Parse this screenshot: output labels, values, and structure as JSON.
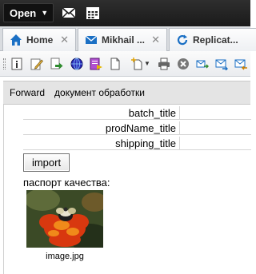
{
  "topbar": {
    "open_label": "Open"
  },
  "tabs": [
    {
      "label": "Home",
      "icon": "home-icon"
    },
    {
      "label": "Mikhail ...",
      "icon": "mail-icon"
    },
    {
      "label": "Replicat...",
      "icon": "refresh-icon"
    }
  ],
  "panel": {
    "forward_label": "Forward",
    "doc_label": "документ обработки"
  },
  "form": {
    "fields": [
      "batch_title",
      "prodName_title",
      "shipping_title"
    ],
    "import_label": "import",
    "passport_label": "паспорт качества:",
    "attachment_caption": "image.jpg"
  },
  "colors": {
    "topbar": "#1f1f1f",
    "tab_icon_blue": "#1a6fc4",
    "panel_bg": "#e4e4e4"
  }
}
